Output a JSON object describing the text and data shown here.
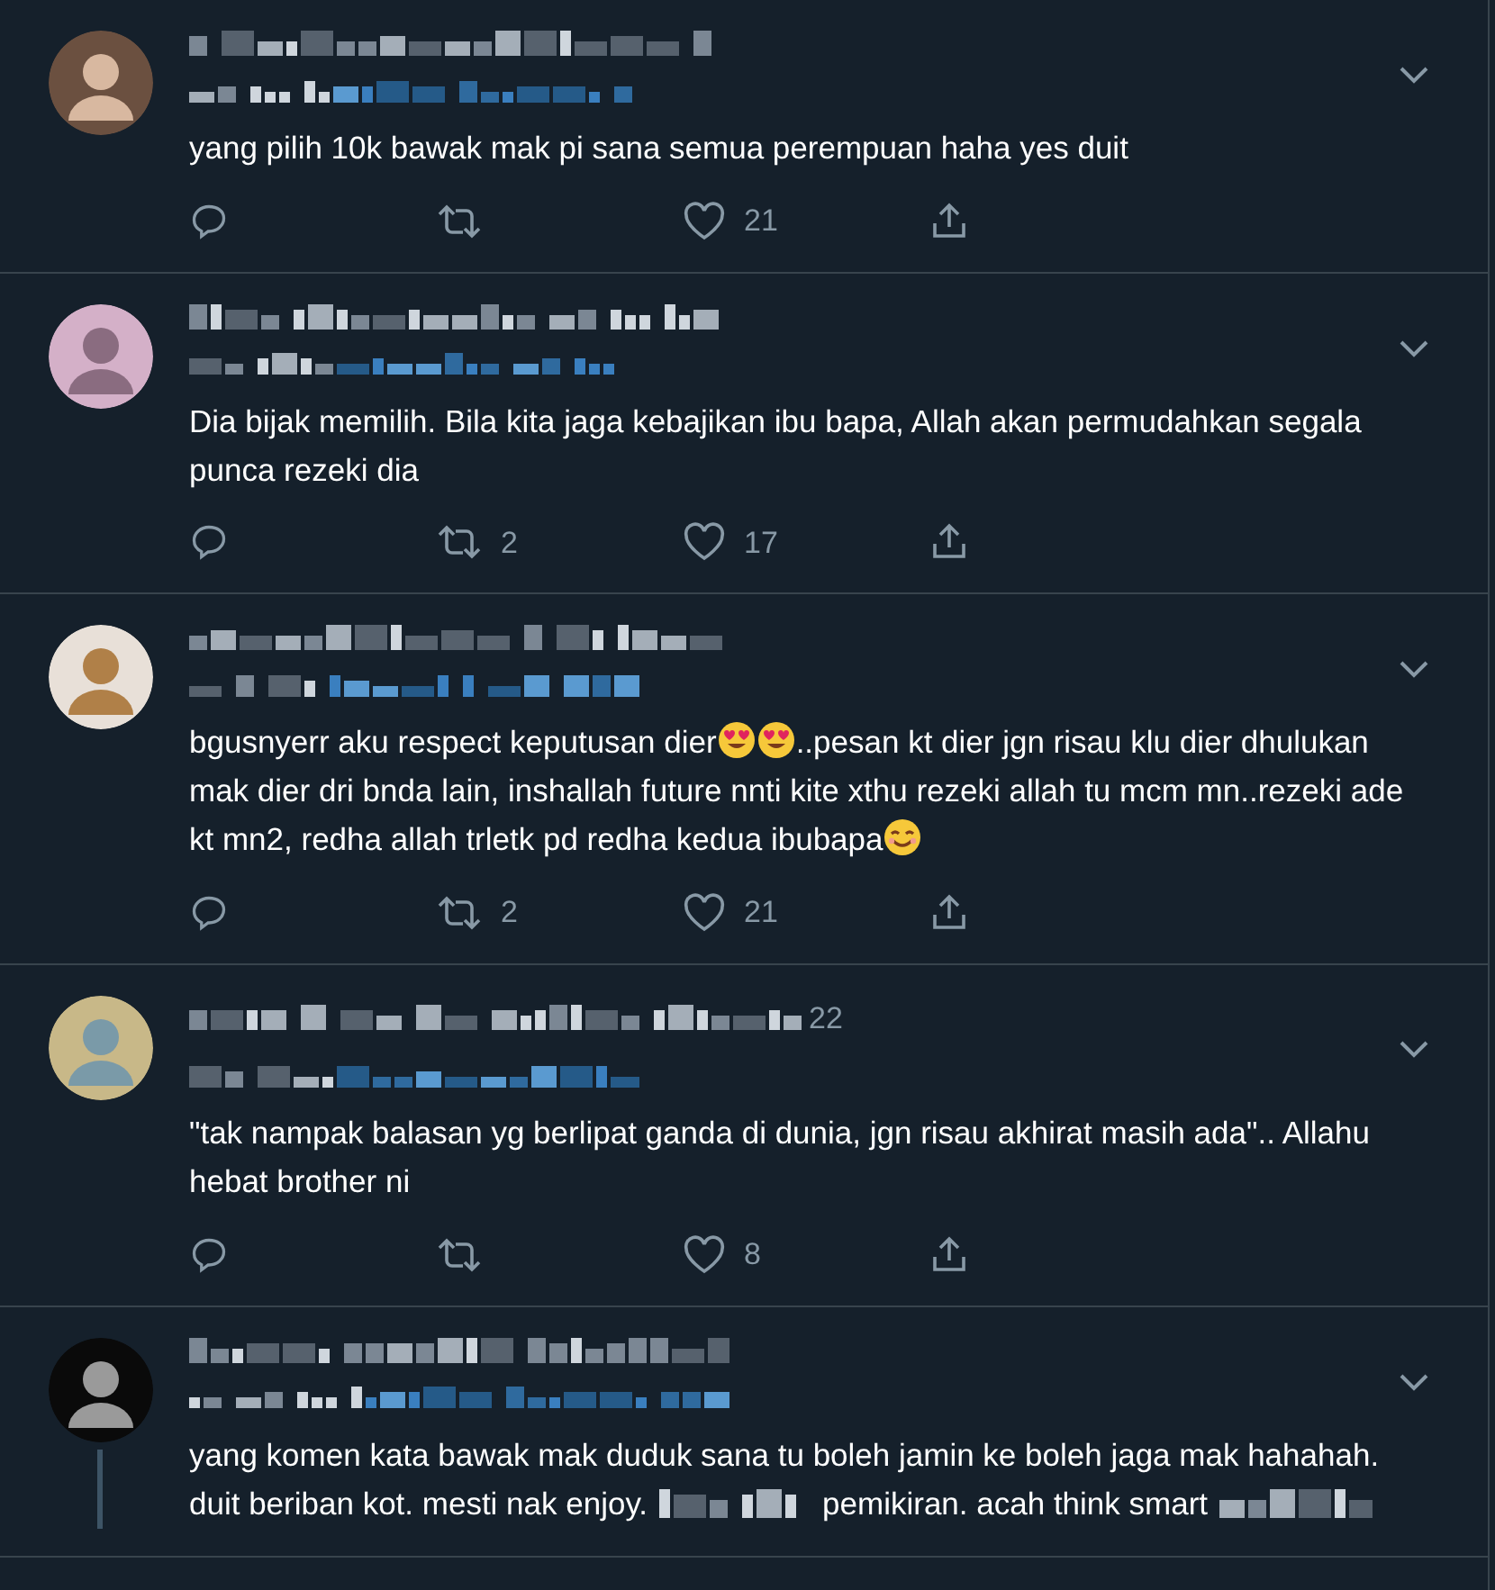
{
  "tweets": [
    {
      "parts": [
        {
          "kind": "text",
          "text": "yang pilih 10k bawak mak pi sana semua perempuan haha yes duit"
        }
      ],
      "likes": "21",
      "thread_line": false
    },
    {
      "parts": [
        {
          "kind": "text",
          "text": "Dia bijak memilih. Bila kita jaga kebajikan ibu bapa, Allah akan permudahkan segala punca rezeki dia"
        }
      ],
      "retweets": "2",
      "likes": "17",
      "thread_line": false
    },
    {
      "parts": [
        {
          "kind": "text",
          "text": "bgusnyerr aku respect keputusan dier"
        },
        {
          "kind": "hearteyes"
        },
        {
          "kind": "hearteyes"
        },
        {
          "kind": "text",
          "text": "..pesan kt dier jgn risau klu dier dhulukan mak dier dri bnda lain, inshallah future nnti kite xthu rezeki allah tu mcm mn..rezeki ade kt mn2, redha allah trletk pd redha kedua ibubapa"
        },
        {
          "kind": "smile"
        }
      ],
      "retweets": "2",
      "likes": "21",
      "thread_line": false
    },
    {
      "header_fragment": "22",
      "parts": [
        {
          "kind": "text",
          "text": "\"tak nampak balasan yg berlipat ganda di dunia, jgn risau akhirat masih ada\".. Allahu hebat brother ni"
        }
      ],
      "likes": "8",
      "thread_line": false
    },
    {
      "parts": [
        {
          "kind": "text",
          "text": "yang komen kata bawak mak duduk sana tu boleh jamin ke boleh jaga mak hahahah. duit beriban kot. mesti nak enjoy."
        },
        {
          "kind": "redacted"
        },
        {
          "kind": "text",
          "text": "pemikiran. acah think smart"
        },
        {
          "kind": "redacted"
        }
      ],
      "thread_line": true
    }
  ]
}
